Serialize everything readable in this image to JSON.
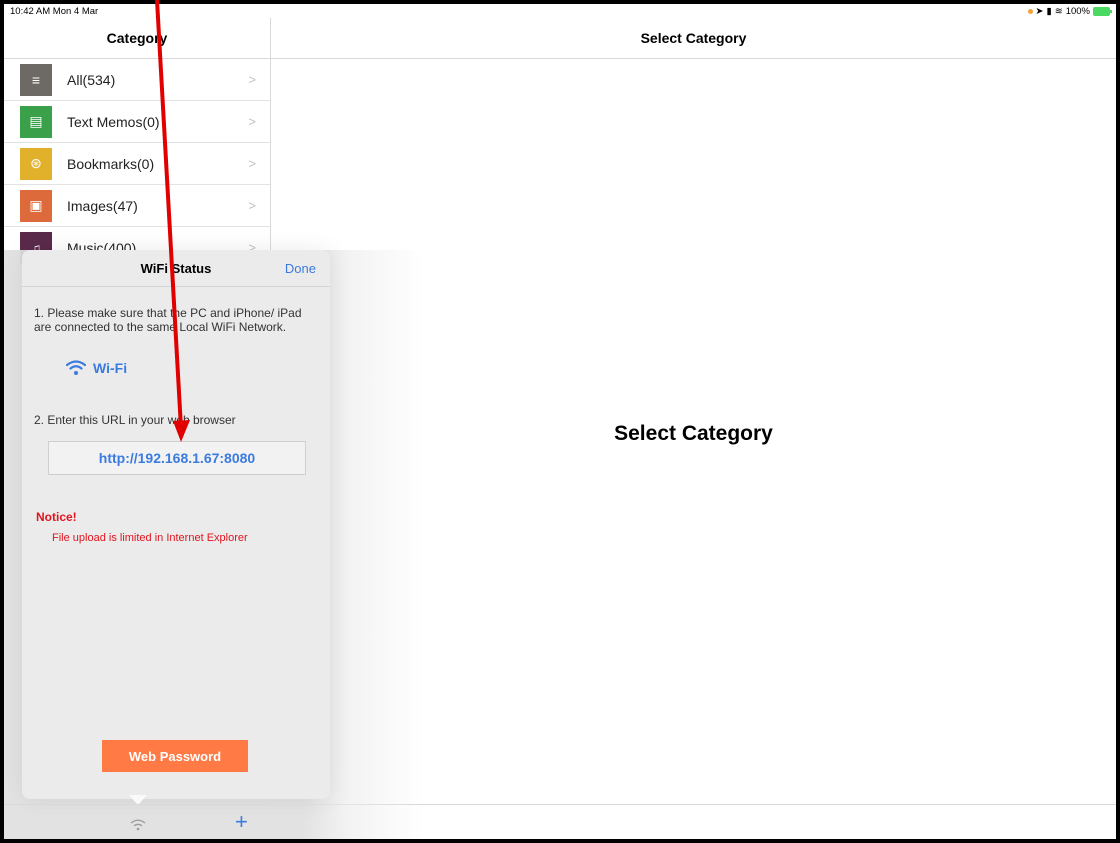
{
  "status_bar": {
    "time": "10:42 AM  Mon 4 Mar",
    "battery": "100%"
  },
  "left_panel": {
    "title": "Category",
    "items": [
      {
        "label": "All(534)",
        "icon": "list-icon",
        "color": "#6d6a65"
      },
      {
        "label": "Text Memos(0)",
        "icon": "memo-icon",
        "color": "#3aa14a"
      },
      {
        "label": "Bookmarks(0)",
        "icon": "compass-icon",
        "color": "#e2b12c"
      },
      {
        "label": "Images(47)",
        "icon": "image-icon",
        "color": "#dc6a3b"
      },
      {
        "label": "Music(400)",
        "icon": "music-icon",
        "color": "#5a2a4a"
      }
    ]
  },
  "right_panel": {
    "title": "Select Category",
    "center_text": "Select Category"
  },
  "popover": {
    "title": "WiFi Status",
    "done": "Done",
    "step1": "1. Please make sure that the PC and iPhone/ iPad are connected to the same Local WiFi Network.",
    "wifi_label": "Wi-Fi",
    "step2": "2. Enter this URL in your web browser",
    "url": "http://192.168.1.67:8080",
    "notice_title": "Notice!",
    "notice_text": "File upload is limited in Internet Explorer",
    "web_password": "Web Password"
  },
  "toolbar": {
    "plus": "+"
  },
  "colors": {
    "accent": "#3b7be0",
    "notice": "#e0141e",
    "button": "#ff7a45",
    "annotation": "#e00000"
  }
}
